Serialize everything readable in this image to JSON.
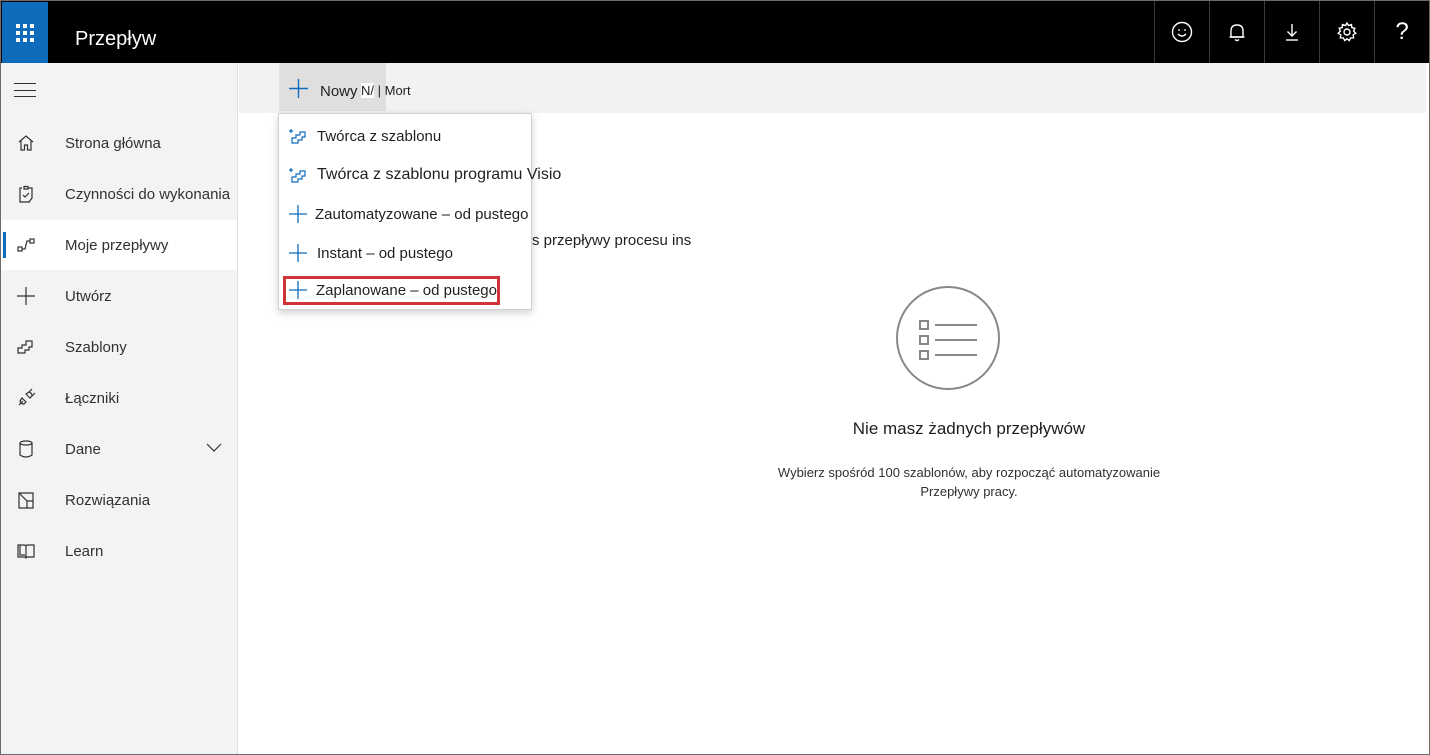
{
  "app": {
    "title": "Przepływ"
  },
  "topbar": {
    "icons": [
      "smiley-icon",
      "bell-icon",
      "download-icon",
      "gear-icon",
      "help-icon"
    ],
    "help_label": "?"
  },
  "sidebar": {
    "items": [
      {
        "label": "Strona główna",
        "icon": "home-icon"
      },
      {
        "label": "Czynności do wykonania",
        "icon": "clipboard-icon"
      },
      {
        "label": "Moje przepływy",
        "icon": "flow-icon",
        "active": true
      },
      {
        "label": "Utwórz",
        "icon": "plus-icon"
      },
      {
        "label": "Szablony",
        "icon": "template-icon"
      },
      {
        "label": "Łączniki",
        "icon": "connector-icon"
      },
      {
        "label": "Dane",
        "icon": "database-icon",
        "expandable": true
      },
      {
        "label": "Rozwiązania",
        "icon": "solutions-icon"
      },
      {
        "label": "Learn",
        "icon": "book-icon"
      }
    ]
  },
  "cmdbar": {
    "new_label": "Nowy",
    "extra_n": "N/",
    "extra_text": "| Mort"
  },
  "dropdown": {
    "items": [
      {
        "label": "Twórca z szablonu",
        "icon": "template-builder-icon"
      },
      {
        "label": "Twórca z szablonu programu Visio",
        "icon": "template-builder-icon"
      },
      {
        "label": "Zautomatyzowane – od pustego",
        "icon": "plus-icon"
      },
      {
        "label": "Instant – od pustego",
        "icon": "plus-icon"
      },
      {
        "label": "Zaplanowane – od pustego",
        "icon": "plus-icon",
        "highlighted": true
      }
    ]
  },
  "main": {
    "behind_text": "s przepływy procesu ins",
    "empty_title": "Nie masz żadnych przepływów",
    "empty_desc_line1": "Wybierz spośród 100 szablonów, aby rozpocząć automatyzowanie",
    "empty_desc_line2": "Przepływy pracy."
  },
  "colors": {
    "accent": "#0f6cbd",
    "topbar": "#000000",
    "highlight_border": "#d13438"
  }
}
